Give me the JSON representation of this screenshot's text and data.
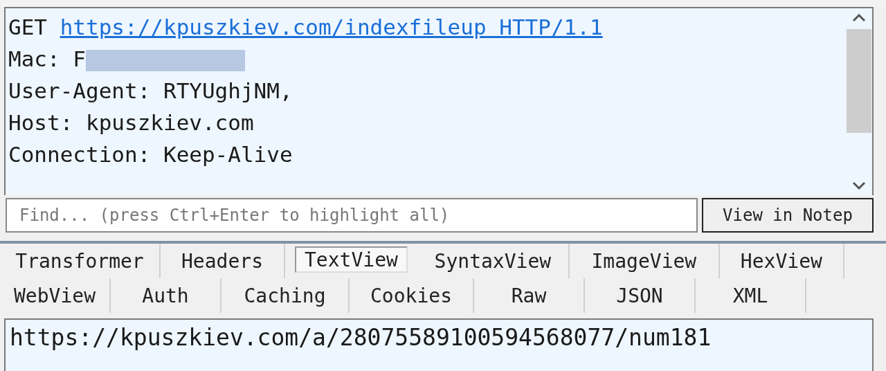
{
  "request_text": {
    "lines": [
      {
        "kind": "request",
        "method": "GET",
        "url": "https://kpuszkiev.com/indexfileup HTTP/1.1"
      },
      {
        "kind": "header",
        "text": "Mac: F",
        "redacted": true
      },
      {
        "kind": "header",
        "text": "User-Agent: RTYUghjNM,",
        "redacted": false
      },
      {
        "kind": "header",
        "text": "Host: kpuszkiev.com",
        "redacted": false
      },
      {
        "kind": "header",
        "text": "Connection: Keep-Alive",
        "redacted": false
      }
    ]
  },
  "find": {
    "placeholder": "Find... (press Ctrl+Enter to highlight all)"
  },
  "notepad_button": "View in Notep",
  "tab_rows": [
    [
      {
        "label": "Transformer",
        "selected": false
      },
      {
        "label": "Headers",
        "selected": false
      },
      {
        "label": "TextView",
        "selected": true
      },
      {
        "label": "SyntaxView",
        "selected": false
      },
      {
        "label": "ImageView",
        "selected": false
      },
      {
        "label": "HexView",
        "selected": false
      }
    ],
    [
      {
        "label": "WebView",
        "selected": false
      },
      {
        "label": "Auth",
        "selected": false
      },
      {
        "label": "Caching",
        "selected": false
      },
      {
        "label": "Cookies",
        "selected": false
      },
      {
        "label": "Raw",
        "selected": false
      },
      {
        "label": "JSON",
        "selected": false
      },
      {
        "label": "XML",
        "selected": false
      }
    ]
  ],
  "response_text": "https://kpuszkiev.com/a/28075589100594568077/num181"
}
